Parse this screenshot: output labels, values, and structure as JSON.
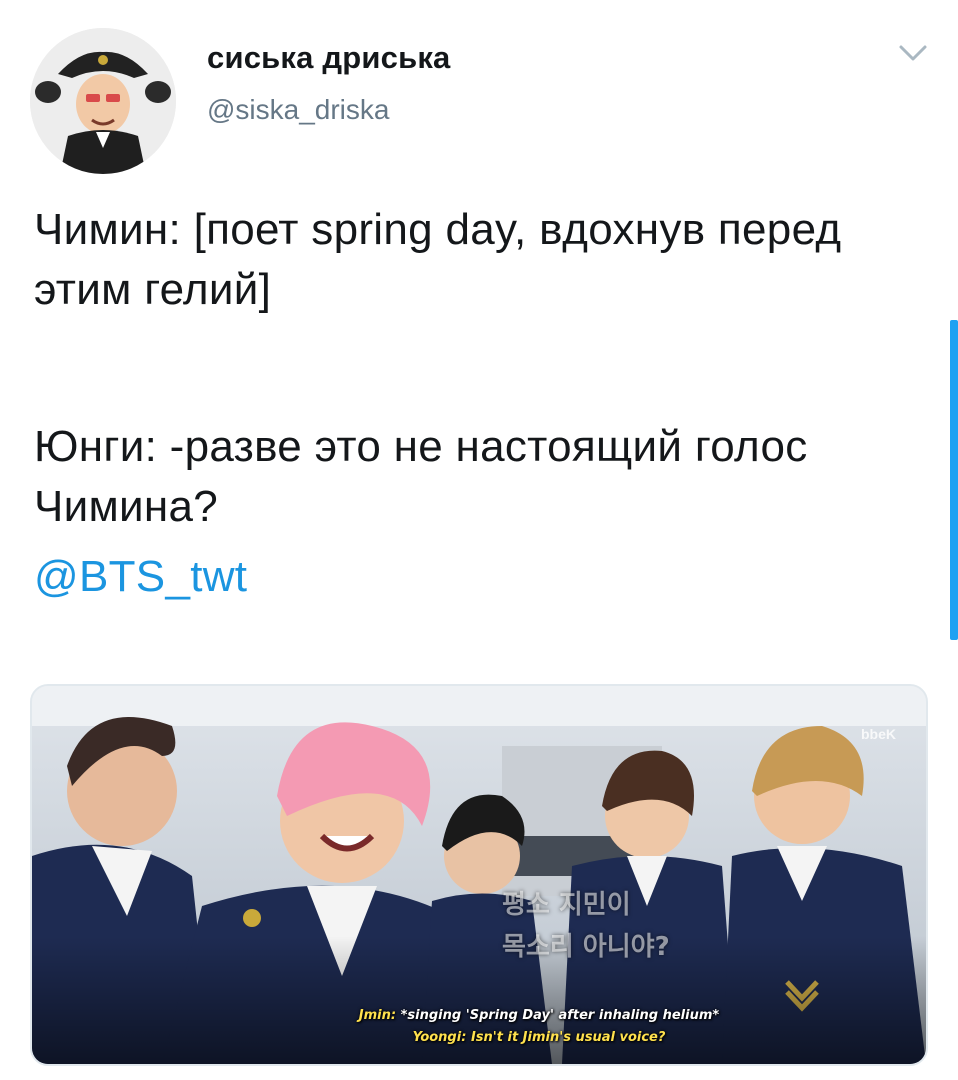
{
  "user": {
    "display_name": "сиська дриська",
    "handle": "@siska_driska",
    "avatar_icon": "avatar-cartoon-face"
  },
  "header": {
    "menu_icon": "chevron-down-icon"
  },
  "tweet": {
    "line1": "Чимин: [поет spring day, вдохнув перед этим гелий]",
    "line2": "Юнги: -разве это не настоящий голос Чимина?",
    "mention": "@BTS_twt"
  },
  "media": {
    "caption_speaker1": "Jmin:",
    "caption_text1": "*singing 'Spring Day' after inhaling helium*",
    "caption_speaker2": "Yoongi:",
    "caption_text2": "Isn't it Jimin's usual voice?",
    "hangul_line1": "평소 지민이",
    "hangul_line2": "목소리 아니야?",
    "watermark": "bbeK"
  },
  "colors": {
    "text": "#14171a",
    "secondary": "#657786",
    "link": "#1b95e0",
    "scrollbar": "#1da1f2"
  }
}
